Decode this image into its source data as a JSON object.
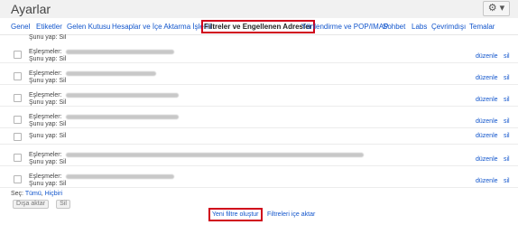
{
  "title": "Ayarlar",
  "gear": "⚙ ▾",
  "tabs": [
    {
      "label": "Genel"
    },
    {
      "label": "Etiketler"
    },
    {
      "label": "Gelen Kutusu"
    },
    {
      "label": "Hesaplar ve İçe Aktarma İşlemi"
    },
    {
      "label": "Filtreler ve Engellenen Adresler",
      "active": true
    },
    {
      "label": "Yönlendirme ve POP/IMAP"
    },
    {
      "label": "Sohbet"
    },
    {
      "label": "Labs"
    },
    {
      "label": "Çevrimdışı"
    },
    {
      "label": "Temalar"
    }
  ],
  "filters": {
    "row0_action": "Şunu yap: Sil",
    "match_label": "Eşleşmeler:",
    "action_label": "Şunu yap: Sil",
    "edit_label": "düzenle",
    "delete_label": "sil"
  },
  "select": {
    "prefix": "Seç:",
    "all": "Tümü",
    "sep": ",",
    "none": "Hiçbiri"
  },
  "buttons": {
    "export": "Dışa aktar",
    "delete": "Sil"
  },
  "links": {
    "create": "Yeni filtre oluştur",
    "import": "Filtreleri içe aktar"
  }
}
